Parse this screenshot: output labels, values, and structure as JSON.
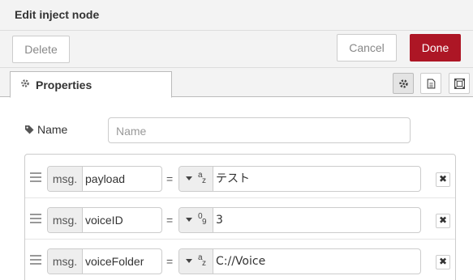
{
  "dialog": {
    "title": "Edit inject node"
  },
  "buttons": {
    "delete": "Delete",
    "cancel": "Cancel",
    "done": "Done"
  },
  "tabs": {
    "properties_label": "Properties",
    "properties_icon": "gear-icon",
    "icons": [
      "gear-icon",
      "document-icon",
      "appearance-icon"
    ]
  },
  "name_field": {
    "label": "Name",
    "placeholder": "Name",
    "value": ""
  },
  "properties": [
    {
      "prefix": "msg.",
      "name": "payload",
      "type": "string",
      "type_glyph_top": "a",
      "type_glyph_bottom": "z",
      "value": "テスト"
    },
    {
      "prefix": "msg.",
      "name": "voiceID",
      "type": "number",
      "type_glyph_top": "0",
      "type_glyph_bottom": "9",
      "value": "3"
    },
    {
      "prefix": "msg.",
      "name": "voiceFolder",
      "type": "string",
      "type_glyph_top": "a",
      "type_glyph_bottom": "z",
      "value": "C://Voice"
    }
  ],
  "equals_sign": "=",
  "remove_symbol": "✖",
  "colors": {
    "done_button": "#ad1625",
    "tray_bg": "#f3f3f3",
    "border": "#cccccc"
  }
}
